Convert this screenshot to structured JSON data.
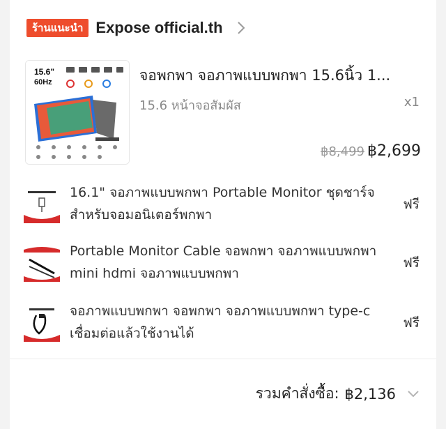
{
  "shop": {
    "badge": "ร้านแนะนำ",
    "name": "Expose official.th",
    "chevron_icon": "chevron-right-icon"
  },
  "product": {
    "thumb_labels": {
      "size": "15.6\"",
      "rate": "60Hz"
    },
    "title": "จอพกพา จอภาพแบบพกพา 15.6นิ้ว 1...",
    "variant": "15.6 หน้าจอสัมผัส",
    "qty": "x1",
    "original_price": "฿8,499",
    "price": "฿2,699"
  },
  "gifts": [
    {
      "title": "16.1\" จอภาพแบบพกพา Portable Monitor ชุดชาร์จสำหรับจอมอนิเตอร์พกพา",
      "price": "ฟรี",
      "icon": "charger-icon"
    },
    {
      "title": "Portable Monitor Cable จอพกพา จอภาพแบบพกพา mini hdmi จอภาพแบบพกพา",
      "price": "ฟรี",
      "icon": "hdmi-cable-icon"
    },
    {
      "title": "จอภาพแบบพกพา จอพกพา จอภาพแบบพกพา type-c เชื่อมต่อแล้วใช้งานได้",
      "price": "ฟรี",
      "icon": "usb-c-cable-icon"
    }
  ],
  "order": {
    "total_label": "รวมคำสั่งซื้อ:",
    "total_value": "฿2,136",
    "chevron_icon": "chevron-down-icon"
  },
  "colors": {
    "accent": "#ee4d2d",
    "text": "#222222",
    "muted": "#8a8a8a"
  }
}
